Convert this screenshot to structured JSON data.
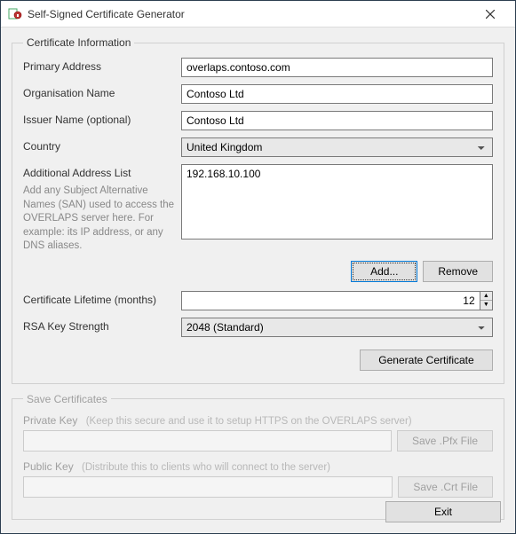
{
  "window": {
    "title": "Self-Signed Certificate Generator"
  },
  "cert_info": {
    "legend": "Certificate Information",
    "primary_address_label": "Primary Address",
    "primary_address_value": "overlaps.contoso.com",
    "org_name_label": "Organisation Name",
    "org_name_value": "Contoso Ltd",
    "issuer_label": "Issuer Name (optional)",
    "issuer_value": "Contoso Ltd",
    "country_label": "Country",
    "country_value": "United Kingdom",
    "addr_list_label": "Additional Address List",
    "addr_list_value": "192.168.10.100",
    "addr_list_helper": "Add any Subject Alternative Names (SAN) used to access the OVERLAPS server here. For example: its IP address, or any DNS aliases.",
    "add_btn": "Add...",
    "remove_btn": "Remove",
    "lifetime_label": "Certificate Lifetime (months)",
    "lifetime_value": "12",
    "rsa_label": "RSA Key Strength",
    "rsa_value": "2048 (Standard)",
    "generate_btn": "Generate Certificate"
  },
  "save": {
    "legend": "Save Certificates",
    "private_label": "Private Key",
    "private_hint": "(Keep this secure and use it to setup HTTPS on the OVERLAPS server)",
    "private_value": "",
    "private_btn": "Save .Pfx File",
    "public_label": "Public Key",
    "public_hint": "(Distribute this to clients who will connect to the server)",
    "public_value": "",
    "public_btn": "Save .Crt File"
  },
  "footer": {
    "exit_btn": "Exit"
  }
}
